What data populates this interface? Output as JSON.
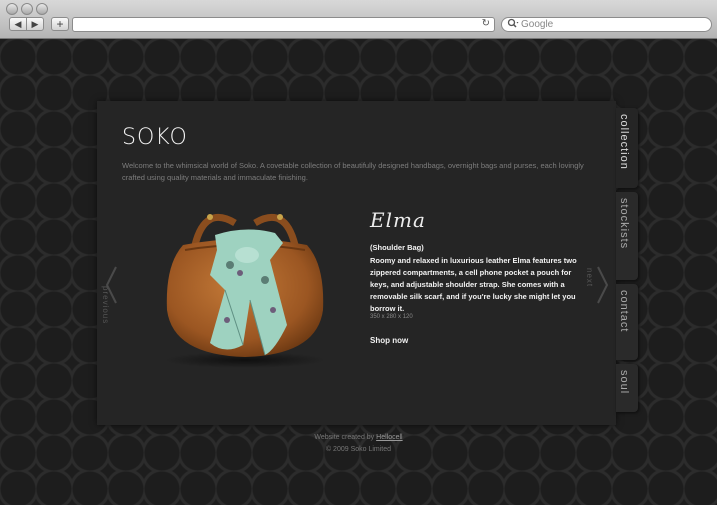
{
  "browser": {
    "search_placeholder": "Google",
    "reload_icon": "↻",
    "back_icon": "◀",
    "forward_icon": "▶",
    "add_icon": "+"
  },
  "site": {
    "logo": "SOKO",
    "intro": "Welcome to the whimsical world of Soko. A covetable collection of beautifully designed handbags, overnight bags and purses, each lovingly crafted using quality materials and immaculate finishing.",
    "nav": {
      "prev_label": "previous",
      "next_label": "next"
    },
    "tabs": [
      {
        "label": "collection",
        "active": true
      },
      {
        "label": "stockists",
        "active": false
      },
      {
        "label": "contact",
        "active": false
      },
      {
        "label": "soul",
        "active": false
      }
    ],
    "product": {
      "name": "Elma",
      "type": "(Shoulder Bag)",
      "description": "Roomy and relaxed in luxurious leather Elma features two zippered compartments, a cell phone pocket a pouch for keys, and adjustable shoulder strap. She comes with a removable silk scarf, and if you're lucky she might let you borrow it.",
      "dimensions": "350 x 280 x 120",
      "cta": "Shop now"
    },
    "footer": {
      "created_prefix": "Website created by ",
      "creator": "Hellocell",
      "copyright": "© 2009 Soko Limited"
    }
  },
  "colors": {
    "bag_leather": "#a8612a",
    "scarf": "#9ed2c0",
    "panel": "#252525"
  }
}
